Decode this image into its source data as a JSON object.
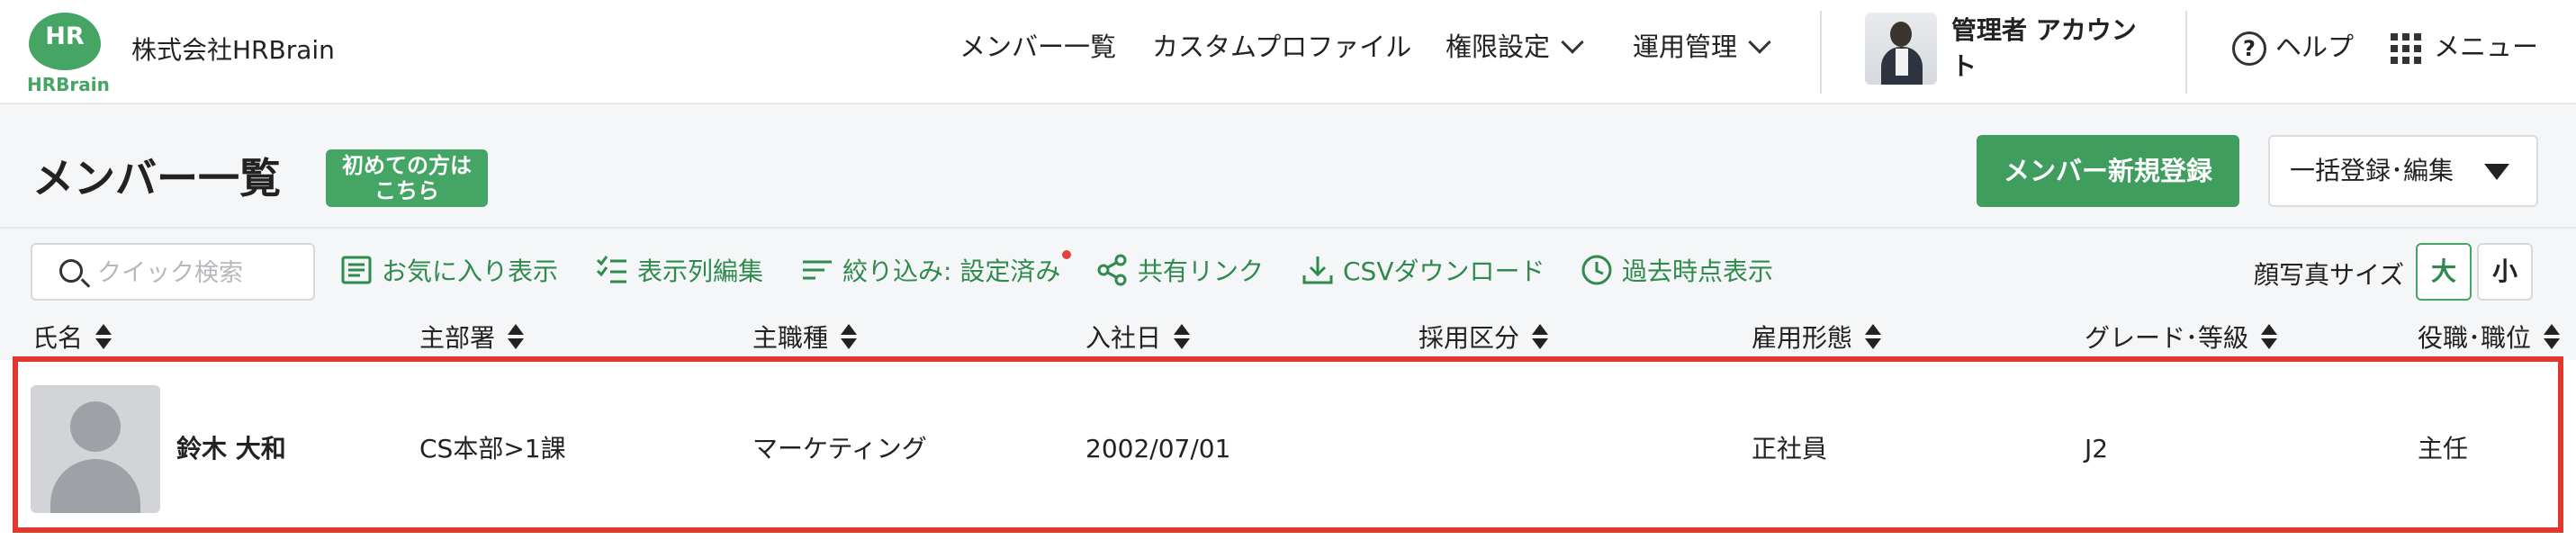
{
  "header": {
    "logo_mark": "HR",
    "logo_word": "HRBrain",
    "company": "株式会社HRBrain",
    "nav": [
      {
        "label": "メンバー一覧"
      },
      {
        "label": "カスタムプロファイル"
      },
      {
        "label": "権限設定"
      },
      {
        "label": "運用管理"
      }
    ],
    "user_name": "管理者 アカウント",
    "help_label": "ヘルプ",
    "menu_label": "メニュー"
  },
  "page": {
    "title": "メンバー一覧",
    "first_time_line1": "初めての方は",
    "first_time_line2": "こちら",
    "new_member_button": "メンバー新規登録",
    "bulk_button": "一括登録･編集"
  },
  "toolbar": {
    "search_placeholder": "クイック検索",
    "favorites": "お気に入り表示",
    "columns": "表示列編集",
    "filter": "絞り込み: 設定済み",
    "share": "共有リンク",
    "csv": "CSVダウンロード",
    "past": "過去時点表示",
    "photo_size_label": "顔写真サイズ",
    "size_large": "大",
    "size_small": "小"
  },
  "table": {
    "columns": [
      "氏名",
      "主部署",
      "主職種",
      "入社日",
      "採用区分",
      "雇用形態",
      "グレード･等級",
      "役職･職位"
    ],
    "rows": [
      {
        "name": "鈴木 大和",
        "department": "CS本部>1課",
        "job_type": "マーケティング",
        "join_date": "2002/07/01",
        "hire_type": "",
        "employment": "正社員",
        "grade": "J2",
        "position": "主任"
      }
    ]
  },
  "colors": {
    "brand_green": "#45a565",
    "link_green": "#2f8a4e",
    "highlight_red": "#e0392b"
  }
}
